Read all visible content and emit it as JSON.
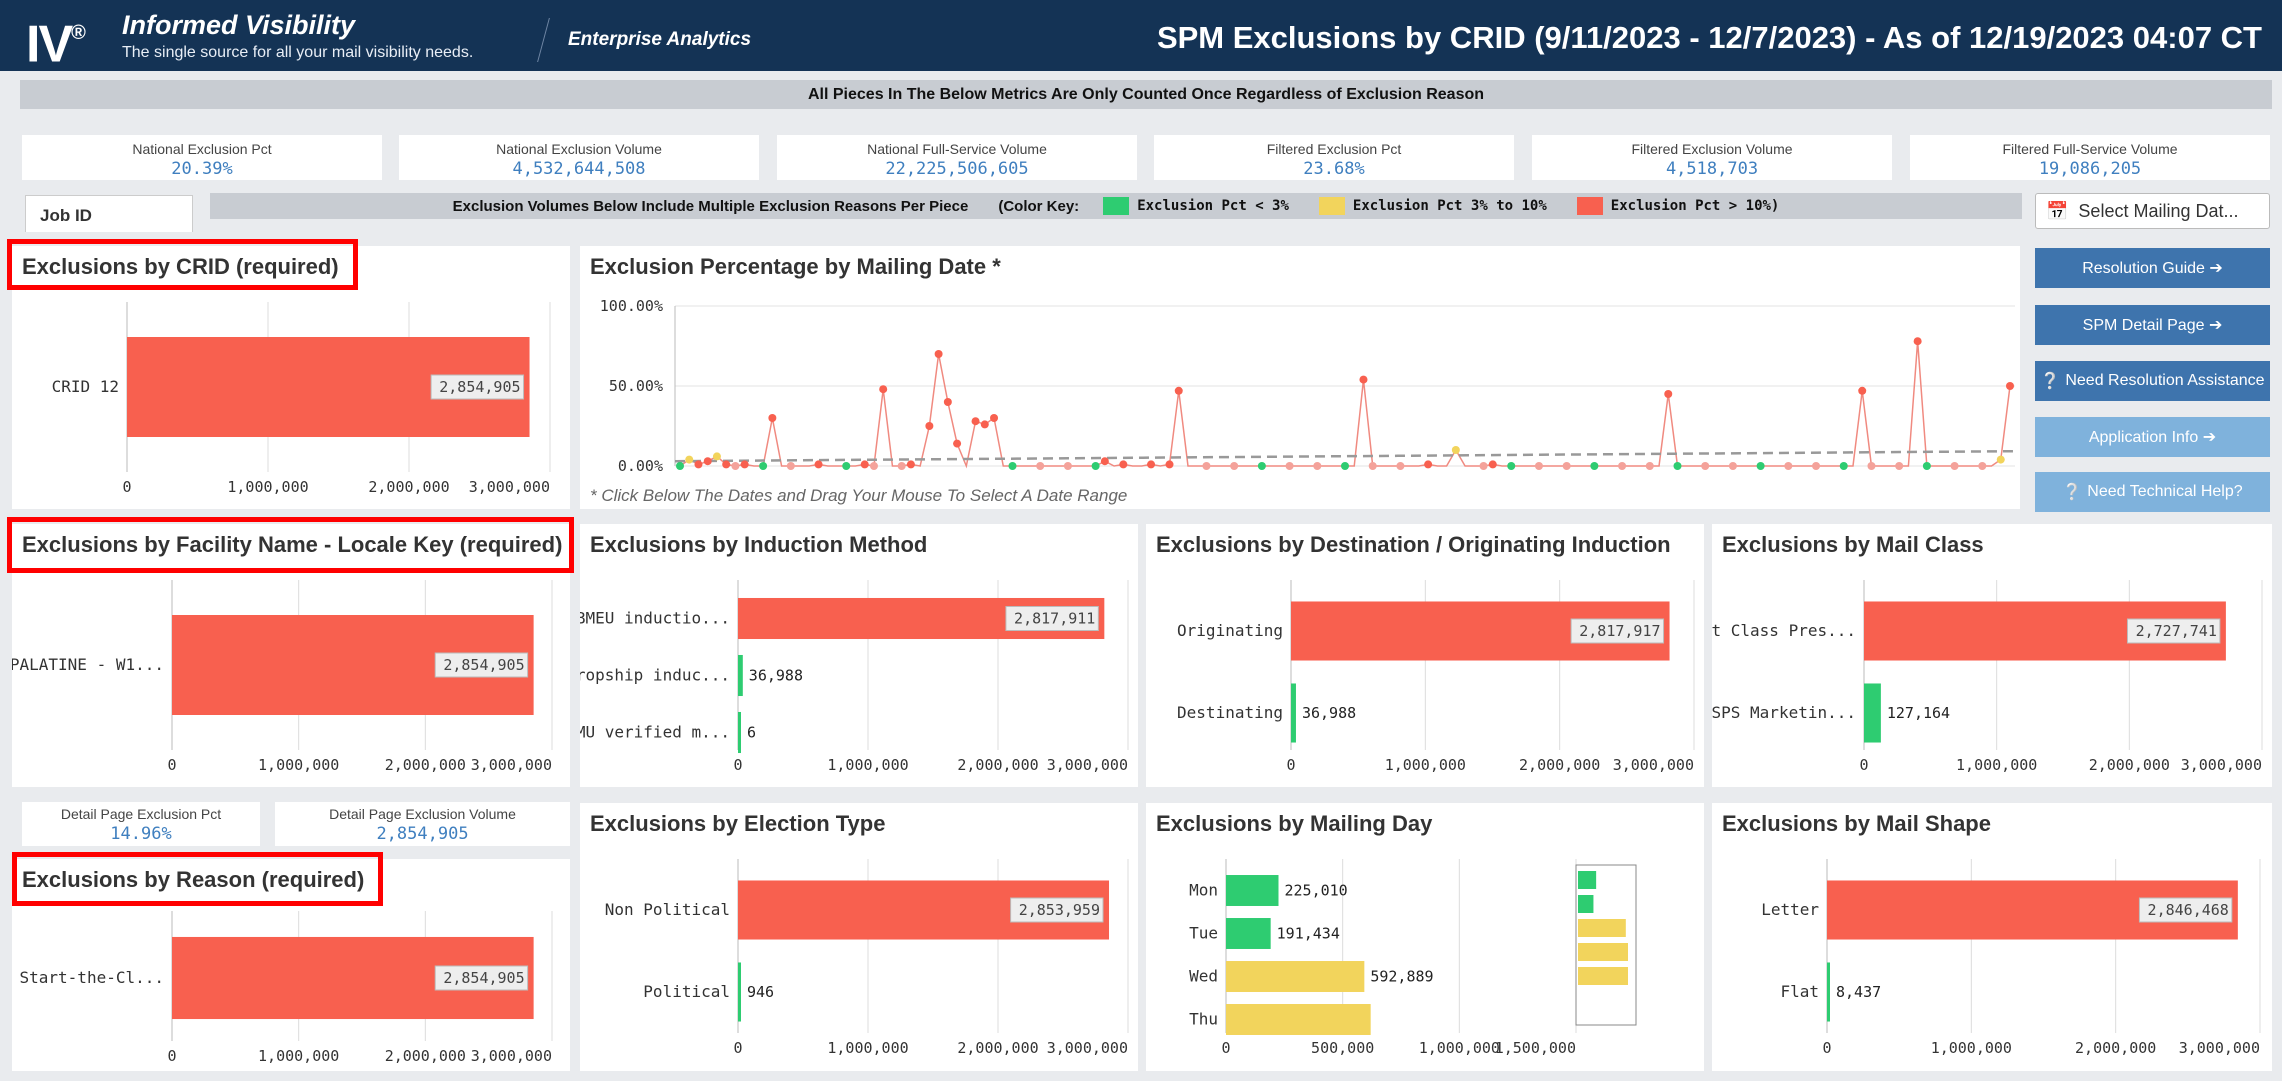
{
  "header": {
    "logo_text": "IV",
    "logo_reg": "®",
    "brand_title": "Informed Visibility",
    "brand_tagline": "The single source for all your mail visibility needs.",
    "enterprise": "Enterprise Analytics",
    "dashboard_title": "SPM Exclusions by CRID (9/11/2023 - 12/7/2023) - As of 12/19/2023 04:07 CT"
  },
  "banner_top": "All Pieces In The Below Metrics Are Only Counted Once Regardless of Exclusion Reason",
  "kpis": [
    {
      "label": "National Exclusion Pct",
      "value": "20.39%"
    },
    {
      "label": "National Exclusion Volume",
      "value": "4,532,644,508"
    },
    {
      "label": "National Full-Service Volume",
      "value": "22,225,506,605"
    },
    {
      "label": "Filtered Exclusion Pct",
      "value": "23.68%"
    },
    {
      "label": "Filtered Exclusion Volume",
      "value": "4,518,703"
    },
    {
      "label": "Filtered Full-Service Volume",
      "value": "19,086,205"
    }
  ],
  "job_id_tab": "Job ID",
  "legend_banner": {
    "text": "Exclusion Volumes Below Include Multiple Exclusion Reasons Per Piece",
    "color_key": "(Color Key:",
    "green": "Exclusion Pct < 3%",
    "yellow": "Exclusion Pct 3% to 10%",
    "red": "Exclusion Pct > 10%)"
  },
  "select_mailing_date": "Select Mailing Dat...",
  "buttons": {
    "resolution_guide": "Resolution Guide ➔",
    "spm_detail": "SPM Detail Page ➔",
    "need_resolution": "Need Resolution Assistance",
    "application_info": "Application Info ➔",
    "need_technical": "Need Technical Help?"
  },
  "colors": {
    "red": "#f8604f",
    "green": "#2ecc71",
    "yellow": "#f2d45c",
    "navy": "#143355",
    "button_dark": "#3e74ad",
    "button_light": "#7fb2dc"
  },
  "panels": {
    "crid": {
      "title": "Exclusions by CRID (required)"
    },
    "mailing_date": {
      "title": "Exclusion Percentage by Mailing Date *",
      "note": "* Click Below The Dates and Drag Your Mouse To Select A Date Range"
    },
    "facility": {
      "title": "Exclusions by Facility Name - Locale Key (required)"
    },
    "induction": {
      "title": "Exclusions by Induction Method"
    },
    "destination": {
      "title": "Exclusions by Destination / Originating Induction"
    },
    "mail_class": {
      "title": "Exclusions by Mail Class"
    },
    "reason": {
      "title": "Exclusions by Reason (required)"
    },
    "election": {
      "title": "Exclusions by Election Type"
    },
    "mailing_day": {
      "title": "Exclusions by Mailing Day"
    },
    "mail_shape": {
      "title": "Exclusions by Mail Shape"
    }
  },
  "detail_kpis": [
    {
      "label": "Detail Page Exclusion Pct",
      "value": "14.96%"
    },
    {
      "label": "Detail Page Exclusion Volume",
      "value": "2,854,905"
    }
  ],
  "chart_data": [
    {
      "id": "crid",
      "type": "bar",
      "orientation": "horizontal",
      "categories": [
        "CRID 12"
      ],
      "values": [
        2854905
      ],
      "labels": [
        "2,854,905"
      ],
      "colors": [
        "red"
      ],
      "xticks": [
        "0",
        "1,000,000",
        "2,000,000",
        "3,000,000"
      ],
      "xlim": [
        0,
        3000000
      ]
    },
    {
      "id": "facility",
      "type": "bar",
      "orientation": "horizontal",
      "categories": [
        "PALATINE - W1..."
      ],
      "values": [
        2854905
      ],
      "labels": [
        "2,854,905"
      ],
      "colors": [
        "red"
      ],
      "xticks": [
        "0",
        "1,000,000",
        "2,000,000",
        "3,000,000"
      ],
      "xlim": [
        0,
        3000000
      ]
    },
    {
      "id": "induction",
      "type": "bar",
      "orientation": "horizontal",
      "categories": [
        "BMEU inductio...",
        "Dropship induc...",
        "DMU verified m..."
      ],
      "values": [
        2817911,
        36988,
        6
      ],
      "labels": [
        "2,817,911",
        "36,988",
        "6"
      ],
      "colors": [
        "red",
        "green",
        "green"
      ],
      "xticks": [
        "0",
        "1,000,000",
        "2,000,000",
        "3,000,000"
      ],
      "xlim": [
        0,
        3000000
      ]
    },
    {
      "id": "destination",
      "type": "bar",
      "orientation": "horizontal",
      "categories": [
        "Originating",
        "Destinating"
      ],
      "values": [
        2817917,
        36988
      ],
      "labels": [
        "2,817,917",
        "36,988"
      ],
      "colors": [
        "red",
        "green"
      ],
      "xticks": [
        "0",
        "1,000,000",
        "2,000,000",
        "3,000,000"
      ],
      "xlim": [
        0,
        3000000
      ]
    },
    {
      "id": "mail_class",
      "type": "bar",
      "orientation": "horizontal",
      "categories": [
        "First Class Pres...",
        "USPS Marketin..."
      ],
      "values": [
        2727741,
        127164
      ],
      "labels": [
        "2,727,741",
        "127,164"
      ],
      "colors": [
        "red",
        "green"
      ],
      "xticks": [
        "0",
        "1,000,000",
        "2,000,000",
        "3,000,000"
      ],
      "xlim": [
        0,
        3000000
      ]
    },
    {
      "id": "reason",
      "type": "bar",
      "orientation": "horizontal",
      "categories": [
        "No Start-the-Cl..."
      ],
      "values": [
        2854905
      ],
      "labels": [
        "2,854,905"
      ],
      "colors": [
        "red"
      ],
      "xticks": [
        "0",
        "1,000,000",
        "2,000,000",
        "3,000,000"
      ],
      "xlim": [
        0,
        3000000
      ]
    },
    {
      "id": "election",
      "type": "bar",
      "orientation": "horizontal",
      "categories": [
        "Non Political",
        "Political"
      ],
      "values": [
        2853959,
        946
      ],
      "labels": [
        "2,853,959",
        "946"
      ],
      "colors": [
        "red",
        "green"
      ],
      "xticks": [
        "0",
        "1,000,000",
        "2,000,000",
        "3,000,000"
      ],
      "xlim": [
        0,
        3000000
      ]
    },
    {
      "id": "mailing_day",
      "type": "bar",
      "orientation": "horizontal",
      "categories": [
        "Mon",
        "Tue",
        "Wed",
        "Thu"
      ],
      "values": [
        225010,
        191434,
        592889,
        620000
      ],
      "labels": [
        "225,010",
        "191,434",
        "592,889",
        ""
      ],
      "colors": [
        "green",
        "green",
        "yellow",
        "yellow"
      ],
      "xticks": [
        "0",
        "500,000",
        "1,000,000",
        "1,500,000"
      ],
      "xlim": [
        0,
        1500000
      ]
    },
    {
      "id": "mail_shape",
      "type": "bar",
      "orientation": "horizontal",
      "categories": [
        "Letter",
        "Flat"
      ],
      "values": [
        2846468,
        8437
      ],
      "labels": [
        "2,846,468",
        "8,437"
      ],
      "colors": [
        "red",
        "green"
      ],
      "xticks": [
        "0",
        "1,000,000",
        "2,000,000",
        "3,000,000"
      ],
      "xlim": [
        0,
        3000000
      ]
    },
    {
      "id": "mailing_date",
      "type": "line",
      "yticks": [
        "0.00%",
        "50.00%",
        "100.00%"
      ],
      "ylim": [
        0,
        100
      ],
      "trend_line": 8,
      "values": [
        0,
        4,
        1,
        3,
        6,
        1,
        0,
        1,
        0,
        0,
        30,
        0,
        0,
        0,
        0,
        1,
        0,
        0,
        0,
        0,
        1,
        0,
        48,
        0,
        0,
        1,
        0,
        25,
        70,
        40,
        14,
        0,
        28,
        26,
        30,
        0,
        0,
        0,
        0,
        0,
        0,
        0,
        0,
        0,
        0,
        0,
        3,
        0,
        1,
        0,
        0,
        1,
        0,
        1,
        47,
        0,
        0,
        0,
        0,
        0,
        0,
        0,
        0,
        0,
        0,
        0,
        0,
        0,
        0,
        0,
        0,
        0,
        0,
        0,
        54,
        0,
        0,
        0,
        0,
        0,
        0,
        1,
        0,
        0,
        10,
        0,
        0,
        0,
        1,
        0,
        0,
        0,
        0,
        0,
        0,
        0,
        0,
        0,
        0,
        0,
        0,
        0,
        0,
        0,
        0,
        0,
        0,
        45,
        0,
        0,
        0,
        0,
        0,
        0,
        0,
        0,
        0,
        0,
        0,
        0,
        0,
        0,
        0,
        0,
        0,
        0,
        0,
        0,
        47,
        0,
        0,
        0,
        0,
        0,
        78,
        0,
        0,
        0,
        0,
        0,
        0,
        0,
        0,
        4,
        50
      ]
    }
  ]
}
